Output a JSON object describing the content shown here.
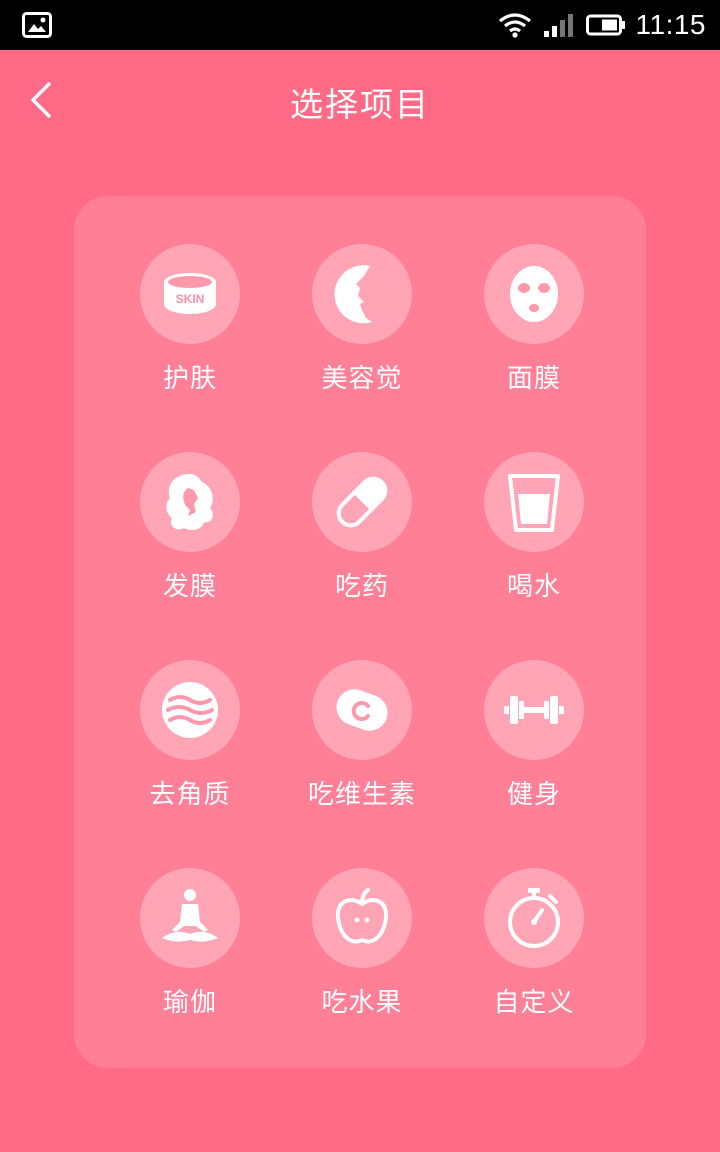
{
  "status_bar": {
    "time": "11:15",
    "icons": [
      "gallery-icon",
      "wifi-icon",
      "signal-icon",
      "battery-icon"
    ]
  },
  "header": {
    "title": "选择项目",
    "back_icon": "chevron-left-icon"
  },
  "items": [
    {
      "label": "护肤",
      "icon": "skin-cream-icon",
      "icon_text": "SKIN"
    },
    {
      "label": "美容觉",
      "icon": "moon-face-icon"
    },
    {
      "label": "面膜",
      "icon": "face-mask-icon"
    },
    {
      "label": "发膜",
      "icon": "hair-icon"
    },
    {
      "label": "吃药",
      "icon": "pill-icon"
    },
    {
      "label": "喝水",
      "icon": "water-glass-icon"
    },
    {
      "label": "去角质",
      "icon": "waves-icon"
    },
    {
      "label": "吃维生素",
      "icon": "vitamin-c-icon"
    },
    {
      "label": "健身",
      "icon": "dumbbell-icon"
    },
    {
      "label": "瑜伽",
      "icon": "yoga-icon"
    },
    {
      "label": "吃水果",
      "icon": "apple-icon"
    },
    {
      "label": "自定义",
      "icon": "stopwatch-icon"
    }
  ],
  "colors": {
    "background": "#ff6b86",
    "status_bar": "#000000",
    "text": "#ffffff"
  }
}
